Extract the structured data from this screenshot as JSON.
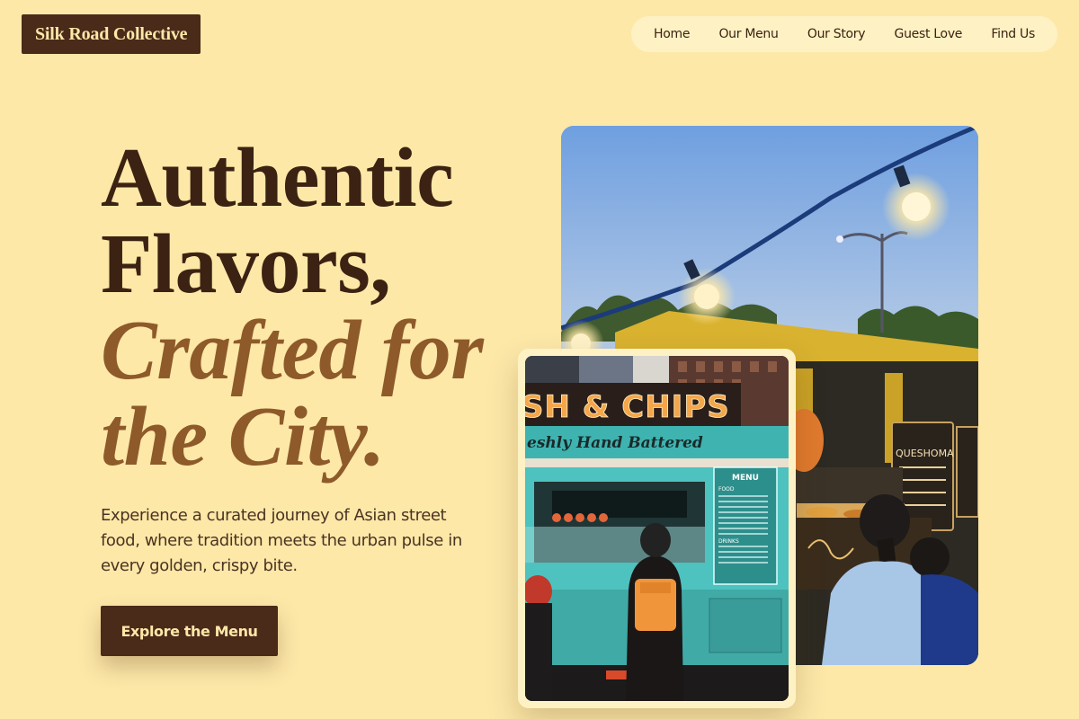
{
  "brand": {
    "name": "Silk Road Collective"
  },
  "nav": {
    "items": [
      {
        "label": "Home"
      },
      {
        "label": "Our Menu"
      },
      {
        "label": "Our Story"
      },
      {
        "label": "Guest Love"
      },
      {
        "label": "Find Us"
      }
    ]
  },
  "hero": {
    "line1": "Authentic",
    "line2": "Flavors,",
    "line3": "Crafted for",
    "line4": "the City.",
    "subtitle": "Experience a curated journey of Asian street food, where tradition meets the urban pulse in every golden, crispy bite.",
    "cta_label": "Explore the Menu"
  },
  "photos": {
    "truck_sign": "SH & CHIPS",
    "truck_subsign": "eshly Hand Battered",
    "truck_menu_title": "MENU",
    "truck_menu_food": "FOOD",
    "truck_menu_drinks": "DRINKS",
    "stall_sign": "QUESHOMA"
  },
  "colors": {
    "background": "#fde8a8",
    "brand_dark": "#4a2a19",
    "accent_brown": "#8e5a2a",
    "nav_pill": "#fef2c4"
  }
}
